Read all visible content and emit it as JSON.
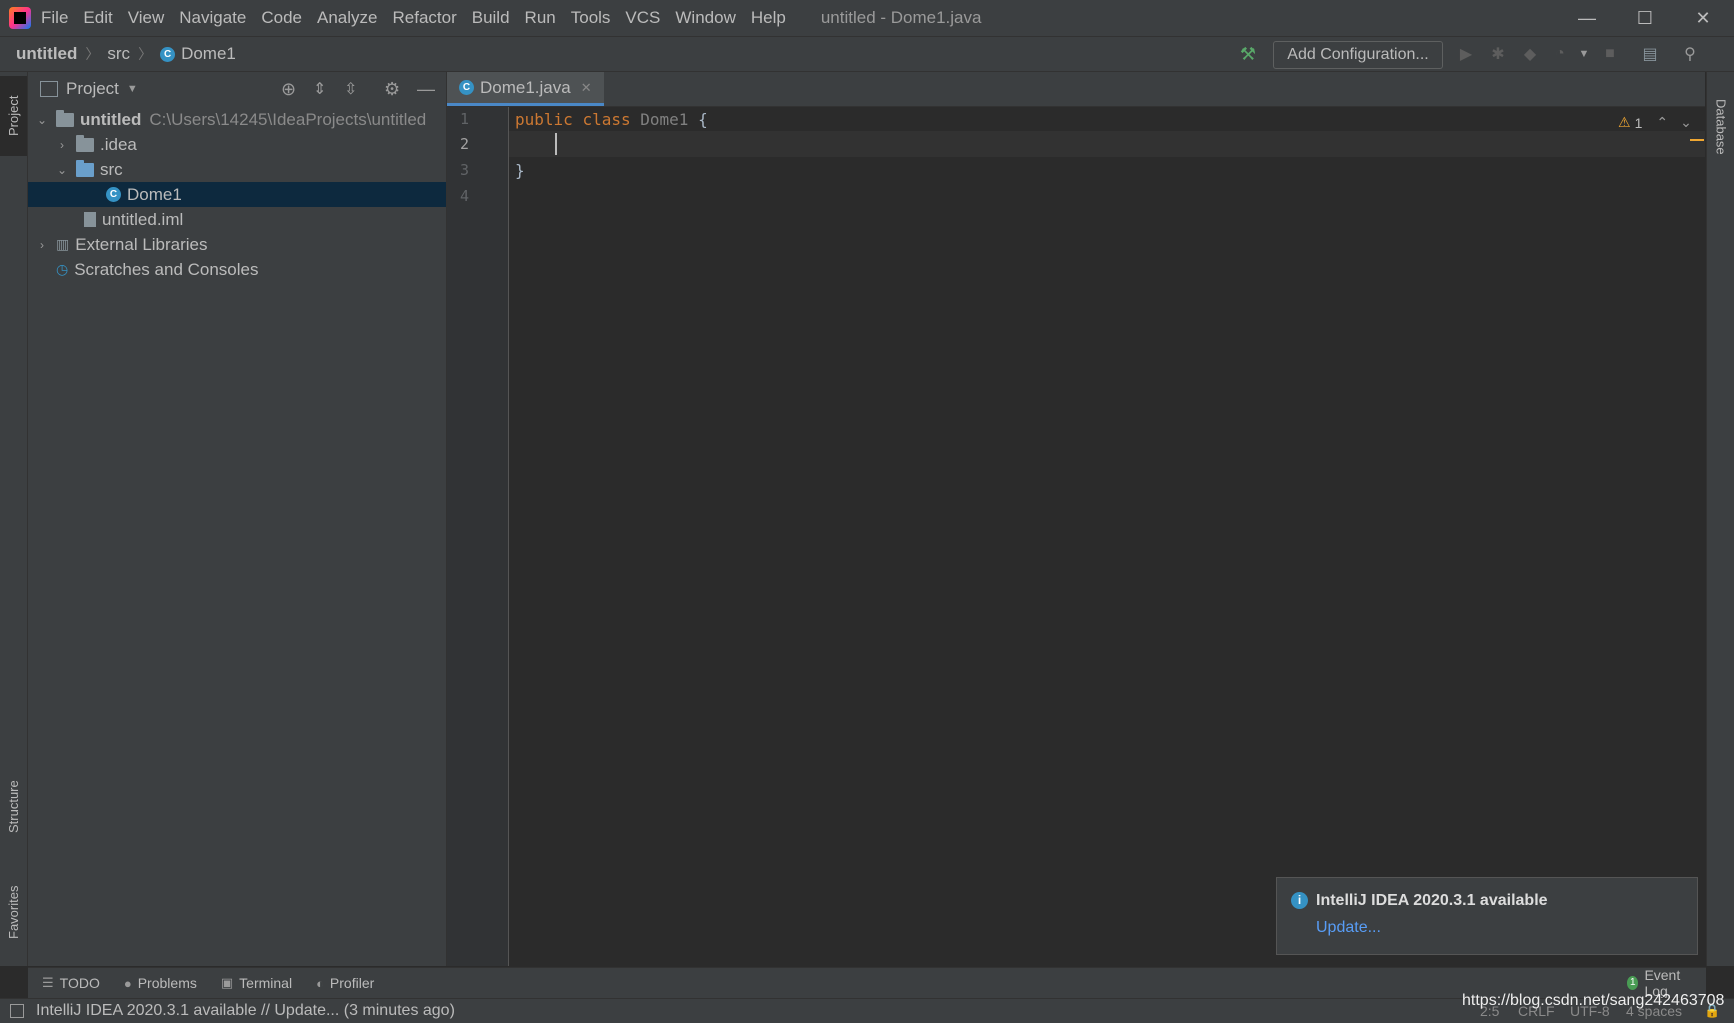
{
  "menu": {
    "items": [
      "File",
      "Edit",
      "View",
      "Navigate",
      "Code",
      "Analyze",
      "Refactor",
      "Build",
      "Run",
      "Tools",
      "VCS",
      "Window",
      "Help"
    ],
    "window_title": "untitled - Dome1.java"
  },
  "window_controls": {
    "minimize": "—",
    "maximize": "☐",
    "close": "✕"
  },
  "breadcrumb": {
    "project": "untitled",
    "folder": "src",
    "file": "Dome1"
  },
  "toolbar": {
    "add_configuration": "Add Configuration..."
  },
  "left_strip": {
    "project_tab": "Project",
    "structure_tab": "Structure",
    "favorites_tab": "Favorites"
  },
  "right_strip": {
    "database_tab": "Database"
  },
  "project_panel": {
    "title": "Project",
    "tree": {
      "root_name": "untitled",
      "root_path": "C:\\Users\\14245\\IdeaProjects\\untitled",
      "idea": ".idea",
      "src": "src",
      "dome1": "Dome1",
      "iml": "untitled.iml",
      "ext_libs": "External Libraries",
      "scratches": "Scratches and Consoles"
    }
  },
  "editor": {
    "tab_label": "Dome1.java",
    "line_numbers": [
      "1",
      "2",
      "3",
      "4"
    ],
    "code": {
      "kw_public": "public",
      "kw_class": "class",
      "class_name": "Dome1",
      "open_brace": "{",
      "close_brace": "}"
    },
    "warnings_count": "1"
  },
  "notification": {
    "title": "IntelliJ IDEA 2020.3.1 available",
    "link": "Update..."
  },
  "bottom_tools": {
    "todo": "TODO",
    "problems": "Problems",
    "terminal": "Terminal",
    "profiler": "Profiler",
    "event_log": "Event Log",
    "event_log_count": "1"
  },
  "status": {
    "message": "IntelliJ IDEA 2020.3.1 available // Update... (3 minutes ago)",
    "position": "2:5",
    "line_sep": "CRLF",
    "encoding": "UTF-8",
    "indent": "4 spaces"
  },
  "watermark": "https://blog.csdn.net/sang242463708",
  "colors": {
    "keyword": "#cc7832",
    "accent": "#4a88c7",
    "class_icon": "#3592c4",
    "warning": "#f0a732",
    "info": "#3592c4",
    "build_hammer": "#59a869"
  }
}
